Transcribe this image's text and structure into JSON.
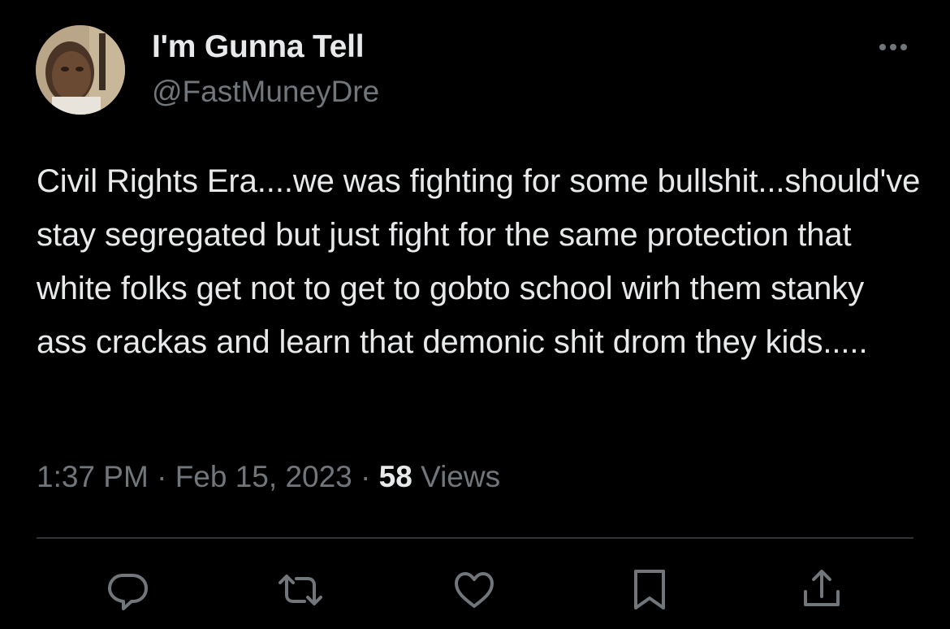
{
  "author": {
    "display_name": "I'm Gunna Tell",
    "handle": "@FastMuneyDre"
  },
  "tweet": {
    "text": "Civil Rights Era....we was fighting for some bullshit...should've stay segregated but just fight for the same protection that white folks get not to get to gobto school wirh them stanky ass crackas and learn that demonic shit drom they kids.....",
    "time": "1:37 PM",
    "separator1": " · ",
    "date": "Feb 15, 2023",
    "separator2": " · ",
    "views_count": "58",
    "views_label": " Views"
  },
  "icons": {
    "more": "more-horizontal-icon",
    "reply": "reply-icon",
    "retweet": "retweet-icon",
    "like": "heart-icon",
    "bookmark": "bookmark-icon",
    "share": "share-icon"
  },
  "colors": {
    "background": "#000000",
    "primary_text": "#e7e9ea",
    "secondary_text": "#71767b",
    "divider": "#2f3336"
  }
}
